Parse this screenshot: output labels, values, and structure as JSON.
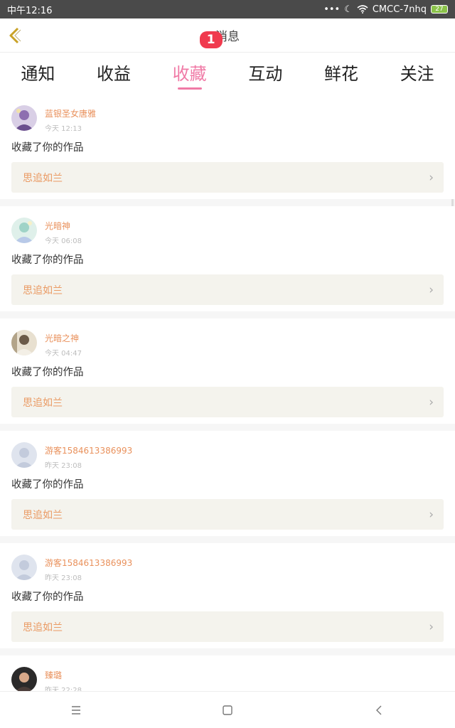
{
  "status_bar": {
    "time": "中午12:16",
    "carrier": "CMCC-7nhq",
    "battery": "27",
    "icons": [
      "more-dots-icon",
      "moon-icon",
      "wifi-icon",
      "battery-icon"
    ]
  },
  "header": {
    "title": "消息",
    "back_icon": "chevron-left-icon"
  },
  "tabs": [
    {
      "label": "通知",
      "active": false
    },
    {
      "label": "收益",
      "active": false
    },
    {
      "label": "收藏",
      "active": true,
      "badge": "1"
    },
    {
      "label": "互动",
      "active": false
    },
    {
      "label": "鲜花",
      "active": false
    },
    {
      "label": "关注",
      "active": false
    }
  ],
  "messages": [
    {
      "user": "蓝银圣女唐雅",
      "time": "今天 12:13",
      "action": "收藏了你的作品",
      "work": "思追如兰",
      "avatar": "purple"
    },
    {
      "user": "光暗神",
      "time": "今天 06:08",
      "action": "收藏了你的作品",
      "work": "思追如兰",
      "avatar": "teal"
    },
    {
      "user": "光暗之神",
      "time": "今天 04:47",
      "action": "收藏了你的作品",
      "work": "思追如兰",
      "avatar": "beige"
    },
    {
      "user": "游客1584613386993",
      "time": "昨天 23:08",
      "action": "收藏了你的作品",
      "work": "思追如兰",
      "avatar": "default"
    },
    {
      "user": "游客1584613386993",
      "time": "昨天 23:08",
      "action": "收藏了你的作品",
      "work": "思追如兰",
      "avatar": "default"
    },
    {
      "user": "臻璐",
      "time": "昨天 22:28",
      "action": "",
      "work": "",
      "avatar": "dark"
    }
  ],
  "bottom_nav": [
    "menu-icon",
    "home-square-icon",
    "back-triangle-icon"
  ],
  "colors": {
    "accent": "#f07aa6",
    "badge": "#f03a4e",
    "username": "#e9915c",
    "work_bg": "#f4f3ed",
    "status_bar": "#4a4a4a"
  }
}
